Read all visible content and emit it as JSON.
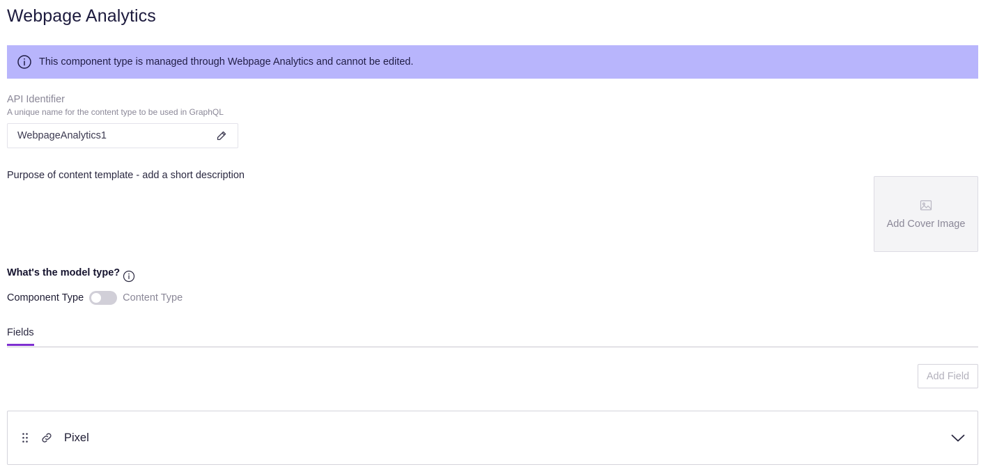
{
  "page": {
    "title": "Webpage Analytics"
  },
  "banner": {
    "message": "This component type is managed through Webpage Analytics and cannot be edited.",
    "icon": "info-circle-icon",
    "background": "#b8b5fc"
  },
  "api": {
    "label": "API Identifier",
    "help": "A unique name for the content type to be used in GraphQL",
    "value": "WebpageAnalytics1",
    "edit_icon": "pencil-icon"
  },
  "description": {
    "text": "Purpose of content template - add a short description"
  },
  "cover": {
    "label": "Add Cover Image",
    "icon": "image-icon"
  },
  "model": {
    "question": "What's the model type?",
    "left_label": "Component Type",
    "right_label": "Content Type",
    "toggle_on": false
  },
  "tabs": [
    {
      "label": "Fields",
      "active": true
    }
  ],
  "add_field": {
    "label": "Add Field",
    "disabled": true
  },
  "fields": [
    {
      "name": "Pixel",
      "icon": "link-icon"
    }
  ],
  "colors": {
    "accent": "#7e2fd0",
    "text": "#1c1a3d",
    "muted": "#8a8797"
  }
}
